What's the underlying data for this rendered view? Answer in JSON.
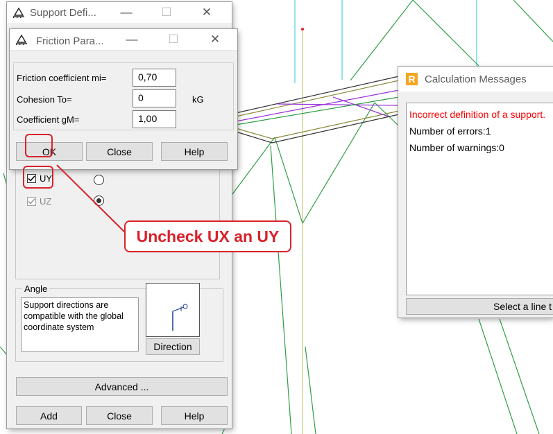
{
  "support_dialog": {
    "title": "Support Defi...",
    "uy_label": "UY",
    "uz_label": "UZ",
    "angle_group_label": "Angle",
    "angle_text": "Support directions are compatible with the global coordinate system",
    "direction_button": "Direction",
    "advanced_button": "Advanced ...",
    "add_button": "Add",
    "close_button": "Close",
    "help_button": "Help"
  },
  "friction_dialog": {
    "title": "Friction Para...",
    "rows": [
      {
        "label": "Friction coefficient mi=",
        "value": "0,70",
        "unit": ""
      },
      {
        "label": "Cohesion To=",
        "value": "0",
        "unit": "kG"
      },
      {
        "label": "Coefficient gM=",
        "value": "1,00",
        "unit": ""
      }
    ],
    "ok_button": "OK",
    "close_button": "Close",
    "help_button": "Help"
  },
  "calc_messages": {
    "title": "Calculation Messages",
    "app_icon_letter": "R",
    "error_line": "Incorrect definition of a support.",
    "errors_line": "Number of errors:1",
    "warnings_line": "Number of warnings:0",
    "status_text": "Select a line t"
  },
  "annotation": {
    "callout_text": "Uncheck UX an UY"
  },
  "colors": {
    "annotation_red": "#d9222a",
    "error_text": "#ff0000"
  }
}
